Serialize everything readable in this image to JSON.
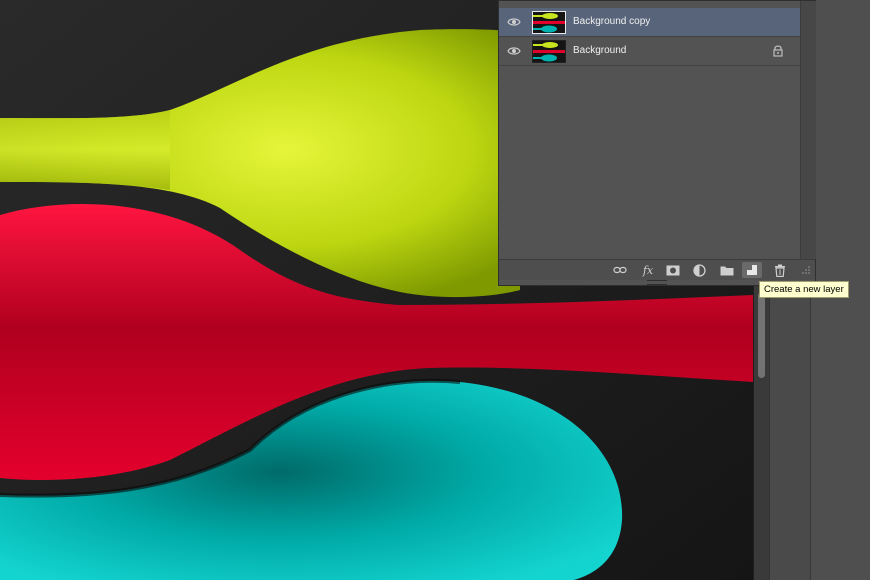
{
  "layers_panel": {
    "layers": [
      {
        "name": "Background copy",
        "selected": true,
        "visible": true,
        "locked": false
      },
      {
        "name": "Background",
        "selected": false,
        "visible": true,
        "locked": true
      }
    ],
    "footer_buttons": [
      {
        "icon": "link-layers-icon"
      },
      {
        "icon": "fx-icon",
        "glyph": "fx"
      },
      {
        "icon": "add-mask-icon"
      },
      {
        "icon": "adjustment-layer-icon"
      },
      {
        "icon": "new-group-folder-icon"
      },
      {
        "icon": "new-layer-icon",
        "active": true
      },
      {
        "icon": "trash-icon"
      }
    ]
  },
  "tooltip": {
    "text": "Create a new layer"
  },
  "canvas": {
    "subject": "three colored spoons",
    "colors": {
      "lime": "#c8e41f",
      "red": "#e0002b",
      "cyan": "#00b3b0",
      "background": "#1c1c1c"
    }
  }
}
